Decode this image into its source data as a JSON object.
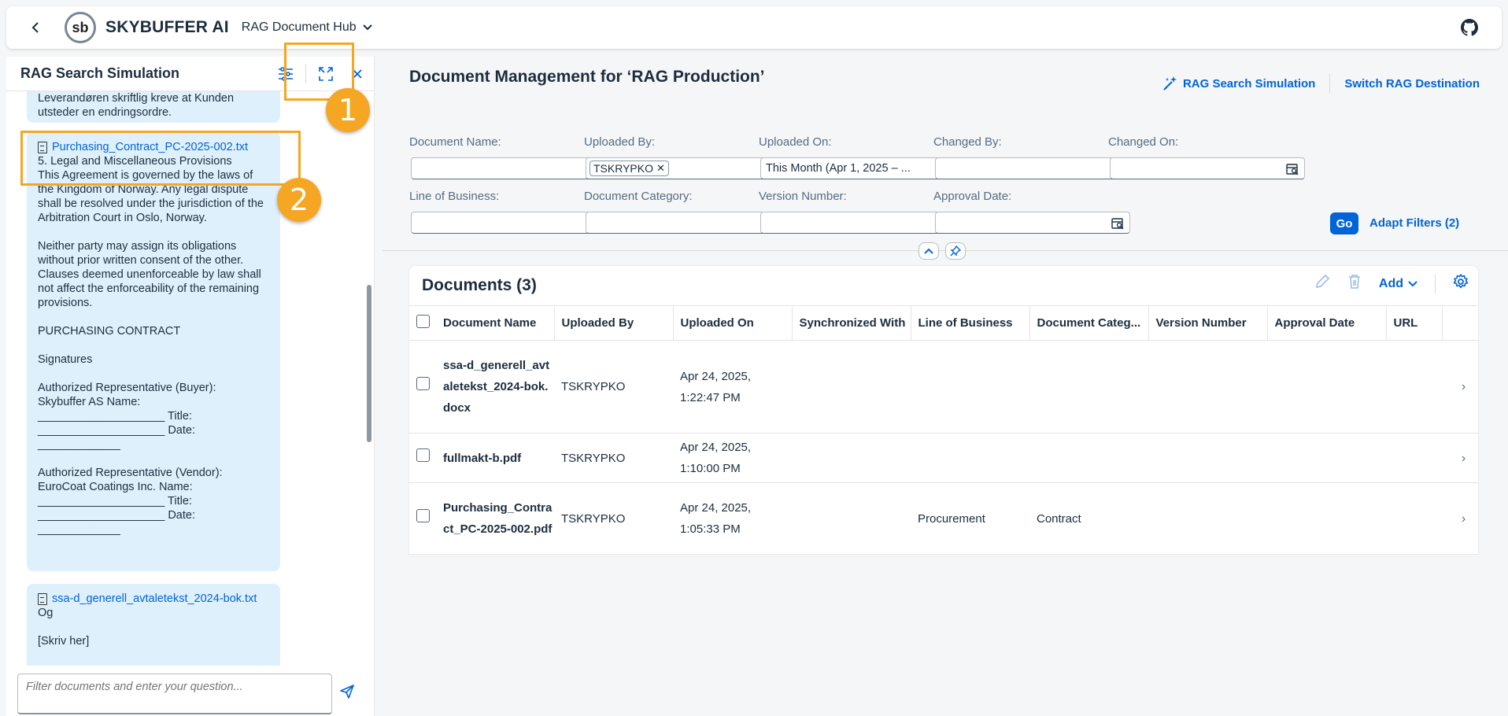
{
  "shell": {
    "logo_text": "sb",
    "brand": "SKYBUFFER AI",
    "app_name": "RAG Document Hub"
  },
  "side_panel": {
    "title": "RAG Search Simulation",
    "messages": [
      {
        "text": "Leverandøren skriftlig kreve at Kunden\nutsteder en endringsordre."
      },
      {
        "file": "Purchasing_Contract_PC-2025-002.txt",
        "text": "5. Legal and Miscellaneous Provisions\nThis Agreement is governed by the laws of the Kingdom of Norway. Any legal dispute shall be resolved under the jurisdiction of the Arbitration Court in Oslo, Norway.\n\nNeither party may assign its obligations without prior written consent of the other. Clauses deemed unenforceable by law shall not affect the enforceability of the remaining provisions.\n\nPURCHASING CONTRACT\n\nSignatures\n\nAuthorized Representative (Buyer):\nSkybuffer AS Name:\n____________________ Title:\n____________________ Date:\n_____________\n\nAuthorized Representative (Vendor):\nEuroCoat Coatings Inc. Name:\n____________________ Title:\n____________________ Date:\n_____________"
      },
      {
        "file": "ssa-d_generell_avtaletekst_2024-bok.txt",
        "text": "Og\n\n[Skriv her]"
      }
    ],
    "input_placeholder": "Filter documents and enter your question..."
  },
  "main": {
    "title": "Document Management for ‘RAG Production’",
    "actions": {
      "rag_search": "RAG Search Simulation",
      "switch": "Switch RAG Destination"
    },
    "filters": {
      "document_name": {
        "label": "Document Name:",
        "value": ""
      },
      "uploaded_by": {
        "label": "Uploaded By:",
        "token": "TSKRYPKO"
      },
      "uploaded_on": {
        "label": "Uploaded On:",
        "value": "This Month (Apr 1, 2025 – ..."
      },
      "changed_by": {
        "label": "Changed By:",
        "value": ""
      },
      "changed_on": {
        "label": "Changed On:",
        "value": ""
      },
      "line_of_business": {
        "label": "Line of Business:",
        "value": ""
      },
      "document_category": {
        "label": "Document Category:",
        "value": ""
      },
      "version_number": {
        "label": "Version Number:",
        "value": ""
      },
      "approval_date": {
        "label": "Approval Date:",
        "value": ""
      }
    },
    "go_label": "Go",
    "adapt_filters": "Adapt Filters (2)"
  },
  "table": {
    "title": "Documents (3)",
    "add_label": "Add",
    "columns": [
      "Document Name",
      "Uploaded By",
      "Uploaded On",
      "Synchronized With",
      "Line of Business",
      "Document Categ...",
      "Version Number",
      "Approval Date",
      "URL"
    ],
    "rows": [
      {
        "name": "ssa-d_generell_avtaletekst_2024-bok.docx",
        "uploaded_by": "TSKRYPKO",
        "uploaded_on": "Apr 24, 2025, 1:22:47 PM",
        "synchronized_with": "",
        "line_of_business": "",
        "category": "",
        "version": "",
        "approval": "",
        "url": ""
      },
      {
        "name": "fullmakt-b.pdf",
        "uploaded_by": "TSKRYPKO",
        "uploaded_on": "Apr 24, 2025, 1:10:00 PM",
        "synchronized_with": "",
        "line_of_business": "",
        "category": "",
        "version": "",
        "approval": "",
        "url": ""
      },
      {
        "name": "Purchasing_Contract_PC-2025-002.pdf",
        "uploaded_by": "TSKRYPKO",
        "uploaded_on": "Apr 24, 2025, 1:05:33 PM",
        "synchronized_with": "",
        "line_of_business": "Procurement",
        "category": "Contract",
        "version": "",
        "approval": "",
        "url": ""
      }
    ]
  },
  "callouts": [
    "1",
    "2"
  ],
  "colors": {
    "accent": "#0064d9",
    "highlight": "#f5a623",
    "bubble": "#dff0fd"
  }
}
